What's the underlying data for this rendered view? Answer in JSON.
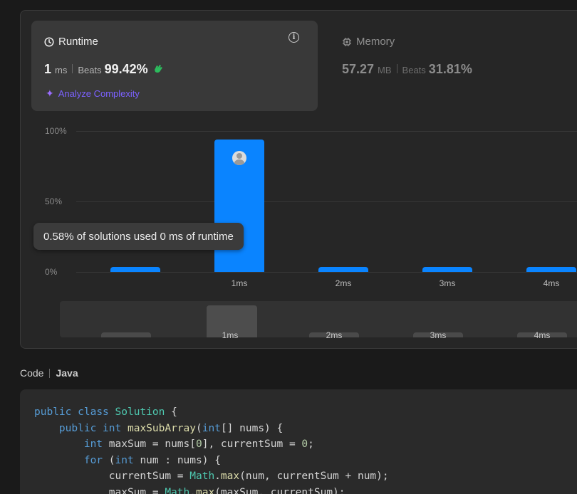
{
  "runtime": {
    "title": "Runtime",
    "value": "1",
    "unit": "ms",
    "beats_label": "Beats",
    "beats_value": "99.42%",
    "analyze_label": "Analyze Complexity"
  },
  "memory": {
    "title": "Memory",
    "value": "57.27",
    "unit": "MB",
    "beats_label": "Beats",
    "beats_value": "31.81%"
  },
  "chart_data": {
    "type": "bar",
    "categories": [
      "0ms",
      "1ms",
      "2ms",
      "3ms",
      "4ms"
    ],
    "tick_labels": [
      "",
      "1ms",
      "2ms",
      "3ms",
      "4ms"
    ],
    "values": [
      0.58,
      94,
      0.3,
      0.3,
      0.3
    ],
    "y_ticks": [
      "100%",
      "50%",
      "0%"
    ],
    "ylim": [
      0,
      100
    ],
    "grid": true,
    "highlight_category": "1ms",
    "bar_color": "#0a84ff"
  },
  "tooltip": {
    "text": "0.58% of solutions used 0 ms of runtime"
  },
  "brush": {
    "labels": [
      "",
      "1ms",
      "2ms",
      "3ms",
      "4ms"
    ]
  },
  "code": {
    "label": "Code",
    "language": "Java"
  },
  "colors": {
    "accent_blue": "#0a84ff",
    "analyze_purple": "#7b61ff",
    "clap_green": "#2cbb5d"
  }
}
